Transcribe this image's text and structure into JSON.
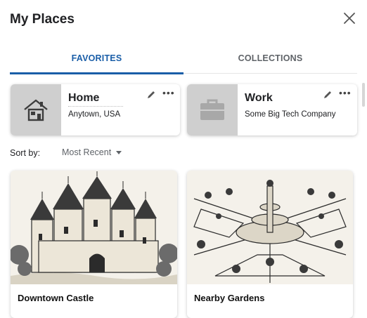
{
  "header": {
    "title": "My Places",
    "close_icon": "close-icon"
  },
  "tabs": [
    {
      "label": "FAVORITES",
      "selected": true
    },
    {
      "label": "COLLECTIONS",
      "selected": false
    }
  ],
  "colors": {
    "accent": "#1a5ea8",
    "placeholder_gray": "#cfcfcf"
  },
  "places": [
    {
      "name": "Home",
      "address": "Anytown, USA",
      "icon": "house-icon"
    },
    {
      "name": "Work",
      "address": "Some Big Tech Company",
      "icon": "briefcase-icon"
    }
  ],
  "sort": {
    "label": "Sort by:",
    "value": "Most Recent"
  },
  "cards": [
    {
      "caption": "Downtown Castle",
      "image": "castle-sketch"
    },
    {
      "caption": "Nearby Gardens",
      "image": "garden-sketch"
    }
  ]
}
